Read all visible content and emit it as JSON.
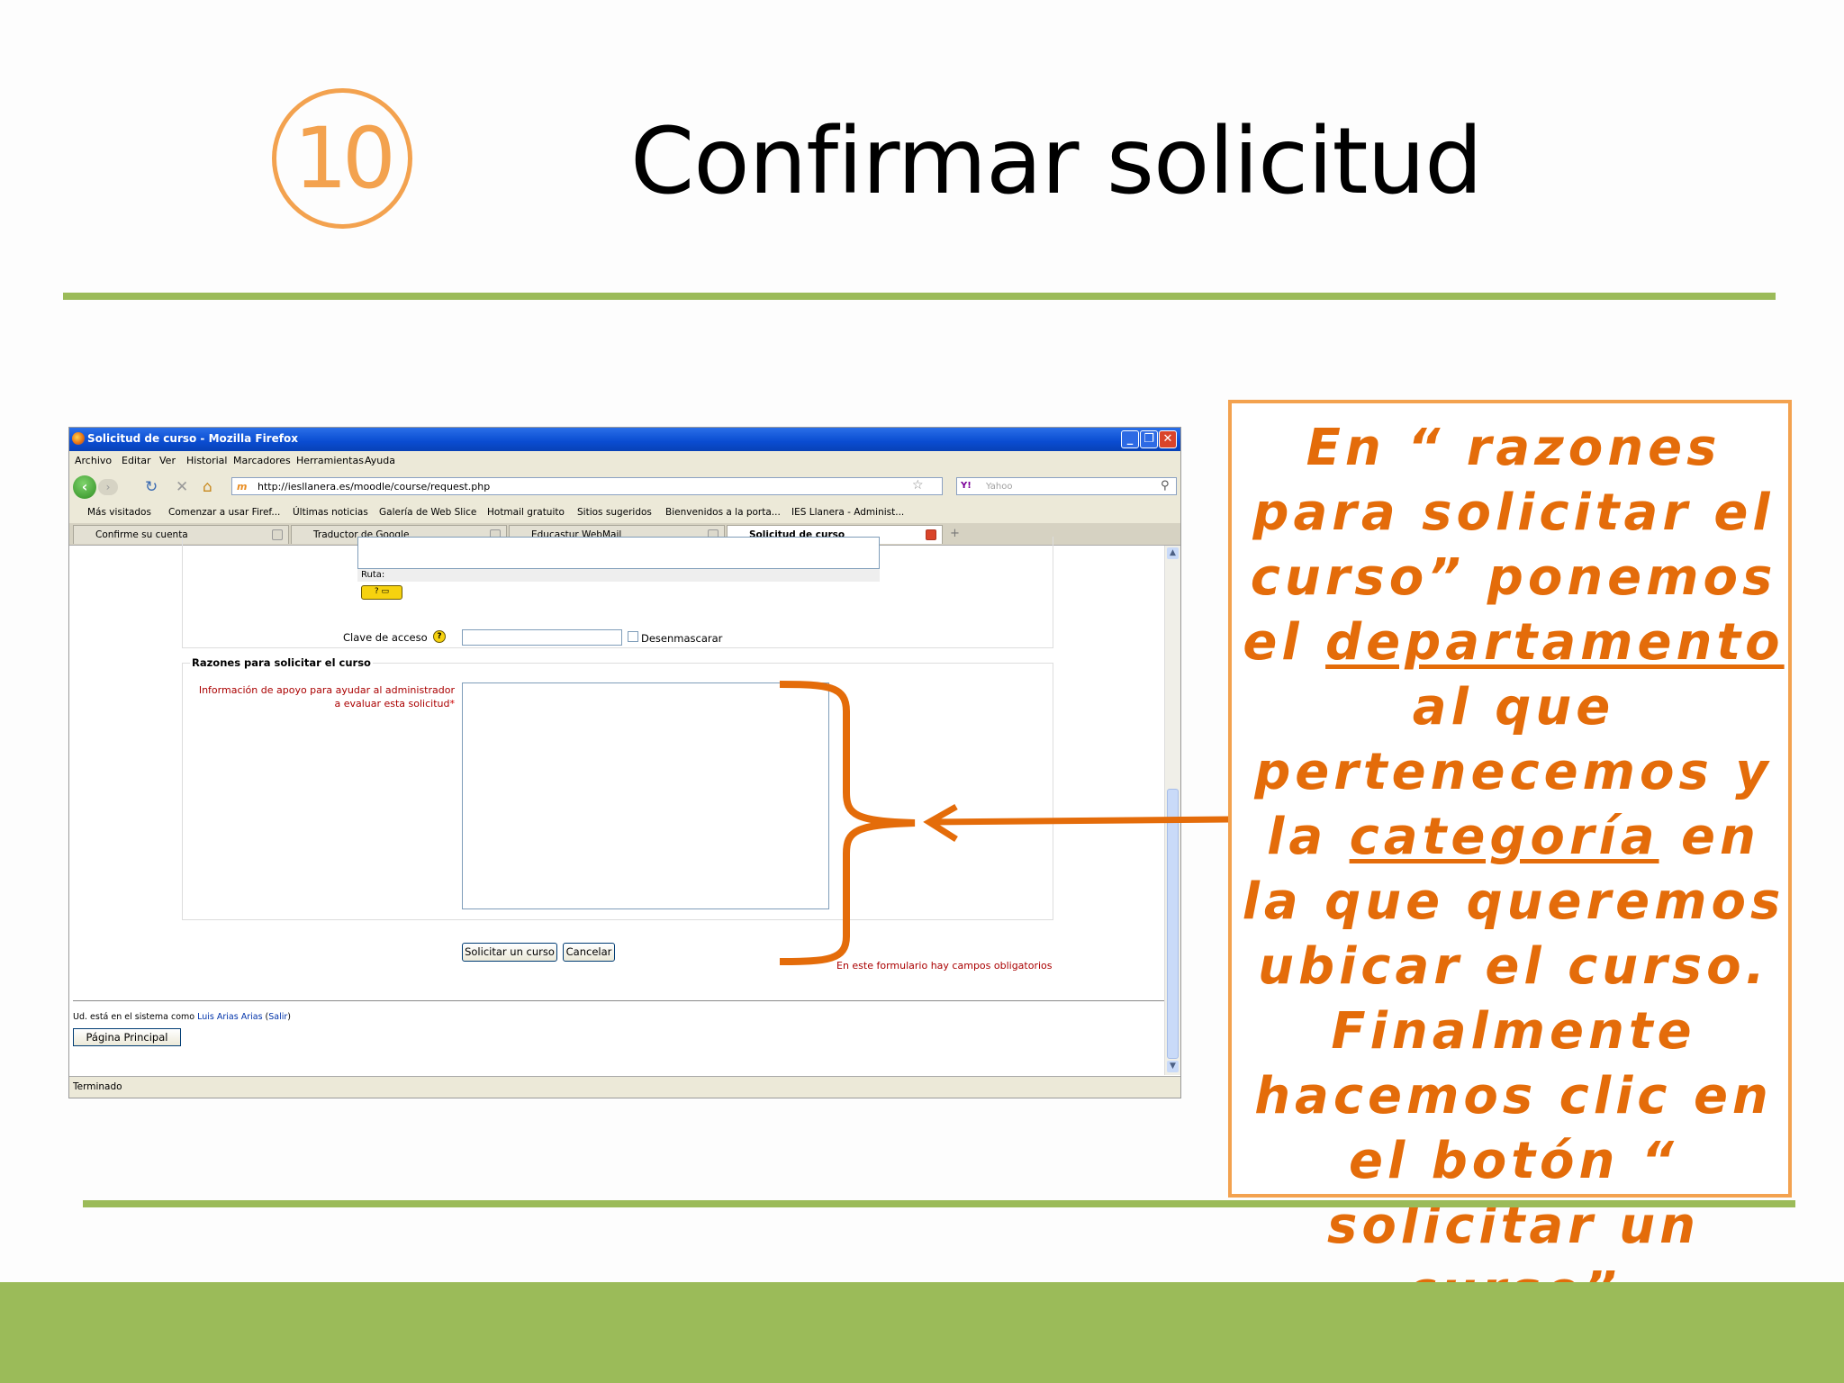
{
  "slide": {
    "step_number": "10",
    "title": "Confirmar solicitud",
    "callout": {
      "part1": "En “ razones para solicitar el curso” ponemos el ",
      "underlined1": "departamento",
      "part2": " al que pertenecemos y la ",
      "underlined2": "categoría",
      "part3": " en la que queremos ubicar el curso. Finalmente hacemos clic en el botón “ solicitar un curso”"
    }
  },
  "browser": {
    "window_title": "Solicitud de curso - Mozilla Firefox",
    "menu": [
      "Archivo",
      "Editar",
      "Ver",
      "Historial",
      "Marcadores",
      "Herramientas",
      "Ayuda"
    ],
    "url": "http://iesllanera.es/moodle/course/request.php",
    "search_placeholder": "Yahoo",
    "bookmarks": [
      "Más visitados",
      "Comenzar a usar Firef...",
      "Últimas noticias",
      "Galería de Web Slice",
      "Hotmail gratuito",
      "Sitios sugeridos",
      "Bienvenidos a la porta...",
      "IES Llanera - Administ..."
    ],
    "tabs": [
      "Confirme su cuenta",
      "Traductor de Google",
      "Educastur WebMail",
      "Solicitud de curso"
    ],
    "status": "Terminado"
  },
  "form": {
    "ruta_label": "Ruta:",
    "clave_label": "Clave de acceso",
    "desenmascarar_label": "Desenmascarar",
    "section_title": "Razones para solicitar el curso",
    "reason_label_line1": "Información de apoyo para ayudar al administrador",
    "reason_label_line2": "a evaluar esta solicitud",
    "required_mark": "*",
    "submit_label": "Solicitar un curso",
    "cancel_label": "Cancelar",
    "required_note": "En este formulario hay campos obligatorios",
    "logged_in_prefix": "Ud. está en el sistema como",
    "user_name": "Luis Arias Arias",
    "logout_label": "Salir",
    "home_button": "Página Principal"
  },
  "colors": {
    "accent_green": "#9bbb59",
    "accent_orange": "#f3a24f",
    "callout_text": "#e46c0a",
    "required_red": "#aa0000"
  }
}
